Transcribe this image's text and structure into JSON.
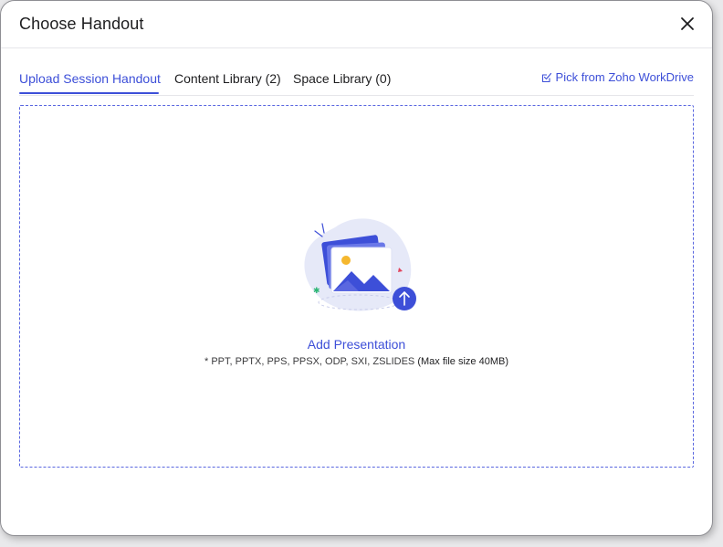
{
  "dialog": {
    "title": "Choose Handout"
  },
  "tabs": [
    {
      "label": "Upload Session Handout",
      "active": true
    },
    {
      "label": "Content Library (2)",
      "active": false
    },
    {
      "label": "Space Library (0)",
      "active": false
    }
  ],
  "workdrive": {
    "label": "Pick from Zoho WorkDrive",
    "icon": "checkbox-edit-icon"
  },
  "upload": {
    "action_label": "Add Presentation",
    "formats": "* PPT, PPTX, PPS, PPSX, ODP, SXI, ZSLIDES",
    "max_size": "(Max file size 40MB)"
  },
  "colors": {
    "accent": "#3d4fd8",
    "border": "#5a67e0"
  }
}
